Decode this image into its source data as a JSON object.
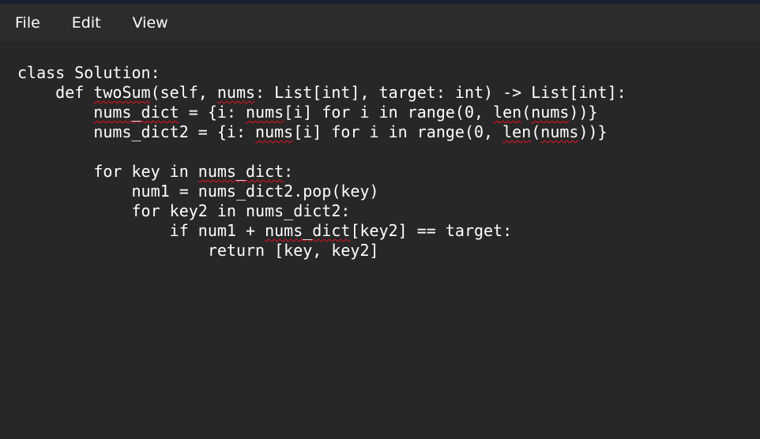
{
  "window": {
    "accent_strip_color": "#1c1f2e",
    "menubar_color": "#2c2c2c",
    "editor_background": "#272727",
    "text_color": "#ffffff",
    "spellcheck_underline_color": "#e81123"
  },
  "menu": {
    "items": [
      "File",
      "Edit",
      "View"
    ]
  },
  "editor": {
    "lines": [
      [
        {
          "t": "class Solution:"
        }
      ],
      [
        {
          "t": "    def "
        },
        {
          "t": "twoSum",
          "m": 1
        },
        {
          "t": "(self, "
        },
        {
          "t": "nums",
          "m": 1
        },
        {
          "t": ": List[int], target: int) -> List[int]:"
        }
      ],
      [
        {
          "t": "        "
        },
        {
          "t": "nums_dict",
          "m": 1
        },
        {
          "t": " = {i: "
        },
        {
          "t": "nums",
          "m": 1
        },
        {
          "t": "[i] for i in range(0, "
        },
        {
          "t": "len",
          "m": 1
        },
        {
          "t": "("
        },
        {
          "t": "nums",
          "m": 1
        },
        {
          "t": "))}"
        }
      ],
      [
        {
          "t": "        nums_dict2 = {i: "
        },
        {
          "t": "nums",
          "m": 1
        },
        {
          "t": "[i] for i in range(0, "
        },
        {
          "t": "len",
          "m": 1
        },
        {
          "t": "("
        },
        {
          "t": "nums",
          "m": 1
        },
        {
          "t": "))}"
        }
      ],
      [
        {
          "t": ""
        }
      ],
      [
        {
          "t": "        for key in "
        },
        {
          "t": "nums_dict",
          "m": 1
        },
        {
          "t": ":"
        }
      ],
      [
        {
          "t": "            num1 = nums_dict2.pop(key)"
        }
      ],
      [
        {
          "t": "            for key2 in nums_dict2:"
        }
      ],
      [
        {
          "t": "                if num1 + "
        },
        {
          "t": "nums_dict",
          "m": 1
        },
        {
          "t": "[key2] == target:"
        }
      ],
      [
        {
          "t": "                    return [key, key2]"
        }
      ]
    ]
  }
}
